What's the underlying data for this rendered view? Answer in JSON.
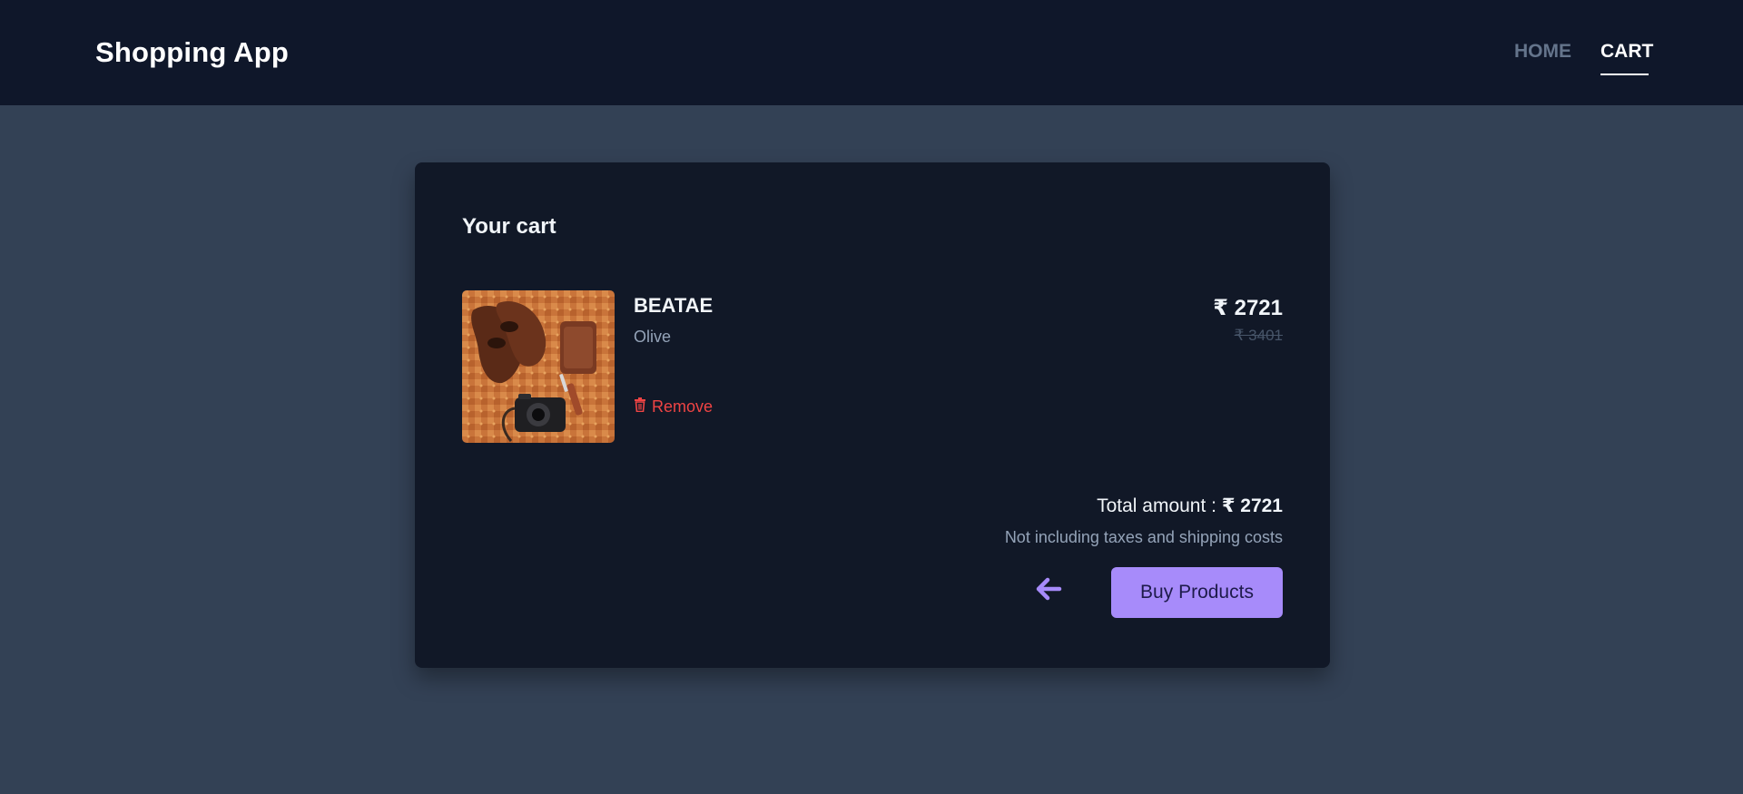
{
  "header": {
    "brand": "Shopping App",
    "nav": [
      {
        "label": "HOME",
        "active": false
      },
      {
        "label": "CART",
        "active": true
      }
    ]
  },
  "cart": {
    "title": "Your cart",
    "items": [
      {
        "name": "BEATAE",
        "color": "Olive",
        "price": "₹ 2721",
        "original_price": "₹ 3401",
        "remove_label": "Remove",
        "image_icon": "product-photo"
      }
    ],
    "total_label": "Total amount : ",
    "total_value": "₹ 2721",
    "note": "Not including taxes and shipping costs",
    "back_icon": "arrow-left-icon",
    "buy_label": "Buy Products"
  },
  "colors": {
    "page_bg": "#334155",
    "navbar_bg": "#0f172a",
    "card_bg": "#111827",
    "accent": "#a78bfa",
    "danger": "#ef4444"
  }
}
